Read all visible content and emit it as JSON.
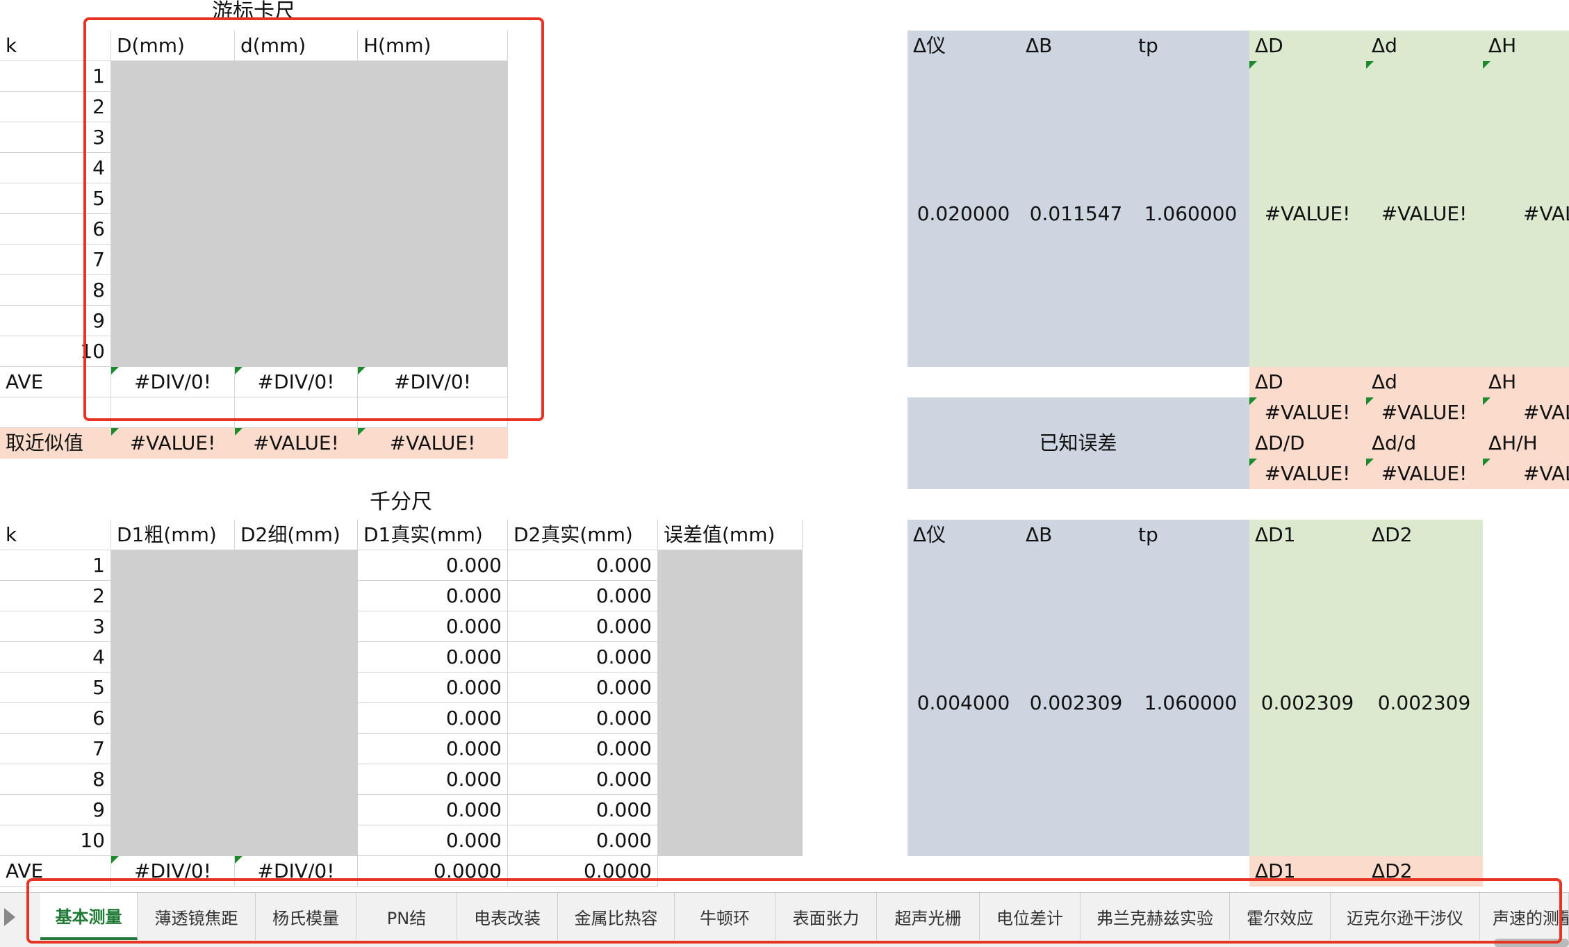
{
  "vernier_title": "游标卡尺",
  "micrometer_title": "千分尺",
  "vernier": {
    "k": "k",
    "D_header": "D(mm)",
    "d_header": "d(mm)",
    "H_header": "H(mm)",
    "rows": [
      "1",
      "2",
      "3",
      "4",
      "5",
      "6",
      "7",
      "8",
      "9",
      "10"
    ],
    "ave_label": "AVE",
    "ave_D": "#DIV/0!",
    "ave_d": "#DIV/0!",
    "ave_H": "#DIV/0!",
    "approx_label": "取近似值",
    "approx_D": "#VALUE!",
    "approx_d": "#VALUE!",
    "approx_H": "#VALUE!"
  },
  "vernier_right": {
    "delta_yi": "Δ仪",
    "delta_B": "ΔB",
    "tp": "tp",
    "delta_D": "ΔD",
    "delta_d": "Δd",
    "delta_H": "ΔH",
    "val_yi": "0.020000",
    "val_B": "0.011547",
    "val_tp": "1.060000",
    "val_D": "#VALUE!",
    "val_d": "#VALUE!",
    "val_H": "#VAL",
    "known_error": "已知误差",
    "abs_D": "ΔD",
    "abs_d": "Δd",
    "abs_H": "ΔH",
    "abs_D_val": "#VALUE!",
    "abs_d_val": "#VALUE!",
    "abs_H_val": "#VAL",
    "rel_D": "ΔD/D",
    "rel_d": "Δd/d",
    "rel_H": "ΔH/H",
    "rel_D_val": "#VALUE!",
    "rel_d_val": "#VALUE!",
    "rel_H_val": "#VAL"
  },
  "micrometer": {
    "k": "k",
    "D1_coarse": "D1粗(mm)",
    "D2_fine": "D2细(mm)",
    "D1_true": "D1真实(mm)",
    "D2_true": "D2真实(mm)",
    "error": "误差值(mm)",
    "rows": [
      "1",
      "2",
      "3",
      "4",
      "5",
      "6",
      "7",
      "8",
      "9",
      "10"
    ],
    "zero": "0.000",
    "ave_label": "AVE",
    "ave_D1": "#DIV/0!",
    "ave_D2": "#DIV/0!",
    "ave_D1_true": "0.0000",
    "ave_D2_true": "0.0000"
  },
  "micrometer_right": {
    "delta_yi": "Δ仪",
    "delta_B": "ΔB",
    "tp": "tp",
    "delta_D1": "ΔD1",
    "delta_D2": "ΔD2",
    "val_yi": "0.004000",
    "val_B": "0.002309",
    "val_tp": "1.060000",
    "val_D1": "0.002309",
    "val_D2": "0.002309",
    "abs_D1": "ΔD1",
    "abs_D2": "ΔD2"
  },
  "tabs": [
    {
      "label": "基本测量",
      "active": true
    },
    {
      "label": "薄透镜焦距"
    },
    {
      "label": "杨氏模量"
    },
    {
      "label": "PN结"
    },
    {
      "label": "电表改装"
    },
    {
      "label": "金属比热容"
    },
    {
      "label": "牛顿环"
    },
    {
      "label": "表面张力"
    },
    {
      "label": "超声光栅"
    },
    {
      "label": "电位差计"
    },
    {
      "label": "弗兰克赫兹实验"
    },
    {
      "label": "霍尔效应"
    },
    {
      "label": "迈克尔逊干涉仪"
    },
    {
      "label": "声速的测量"
    }
  ],
  "colors": {
    "highlight_box": "#e83223",
    "input_gray": "#cfcfcf",
    "blue_fill": "#cdd5e0",
    "green_fill": "#dbeacf",
    "salmon_fill": "#fadbcc",
    "active_tab": "#1e7a34"
  }
}
